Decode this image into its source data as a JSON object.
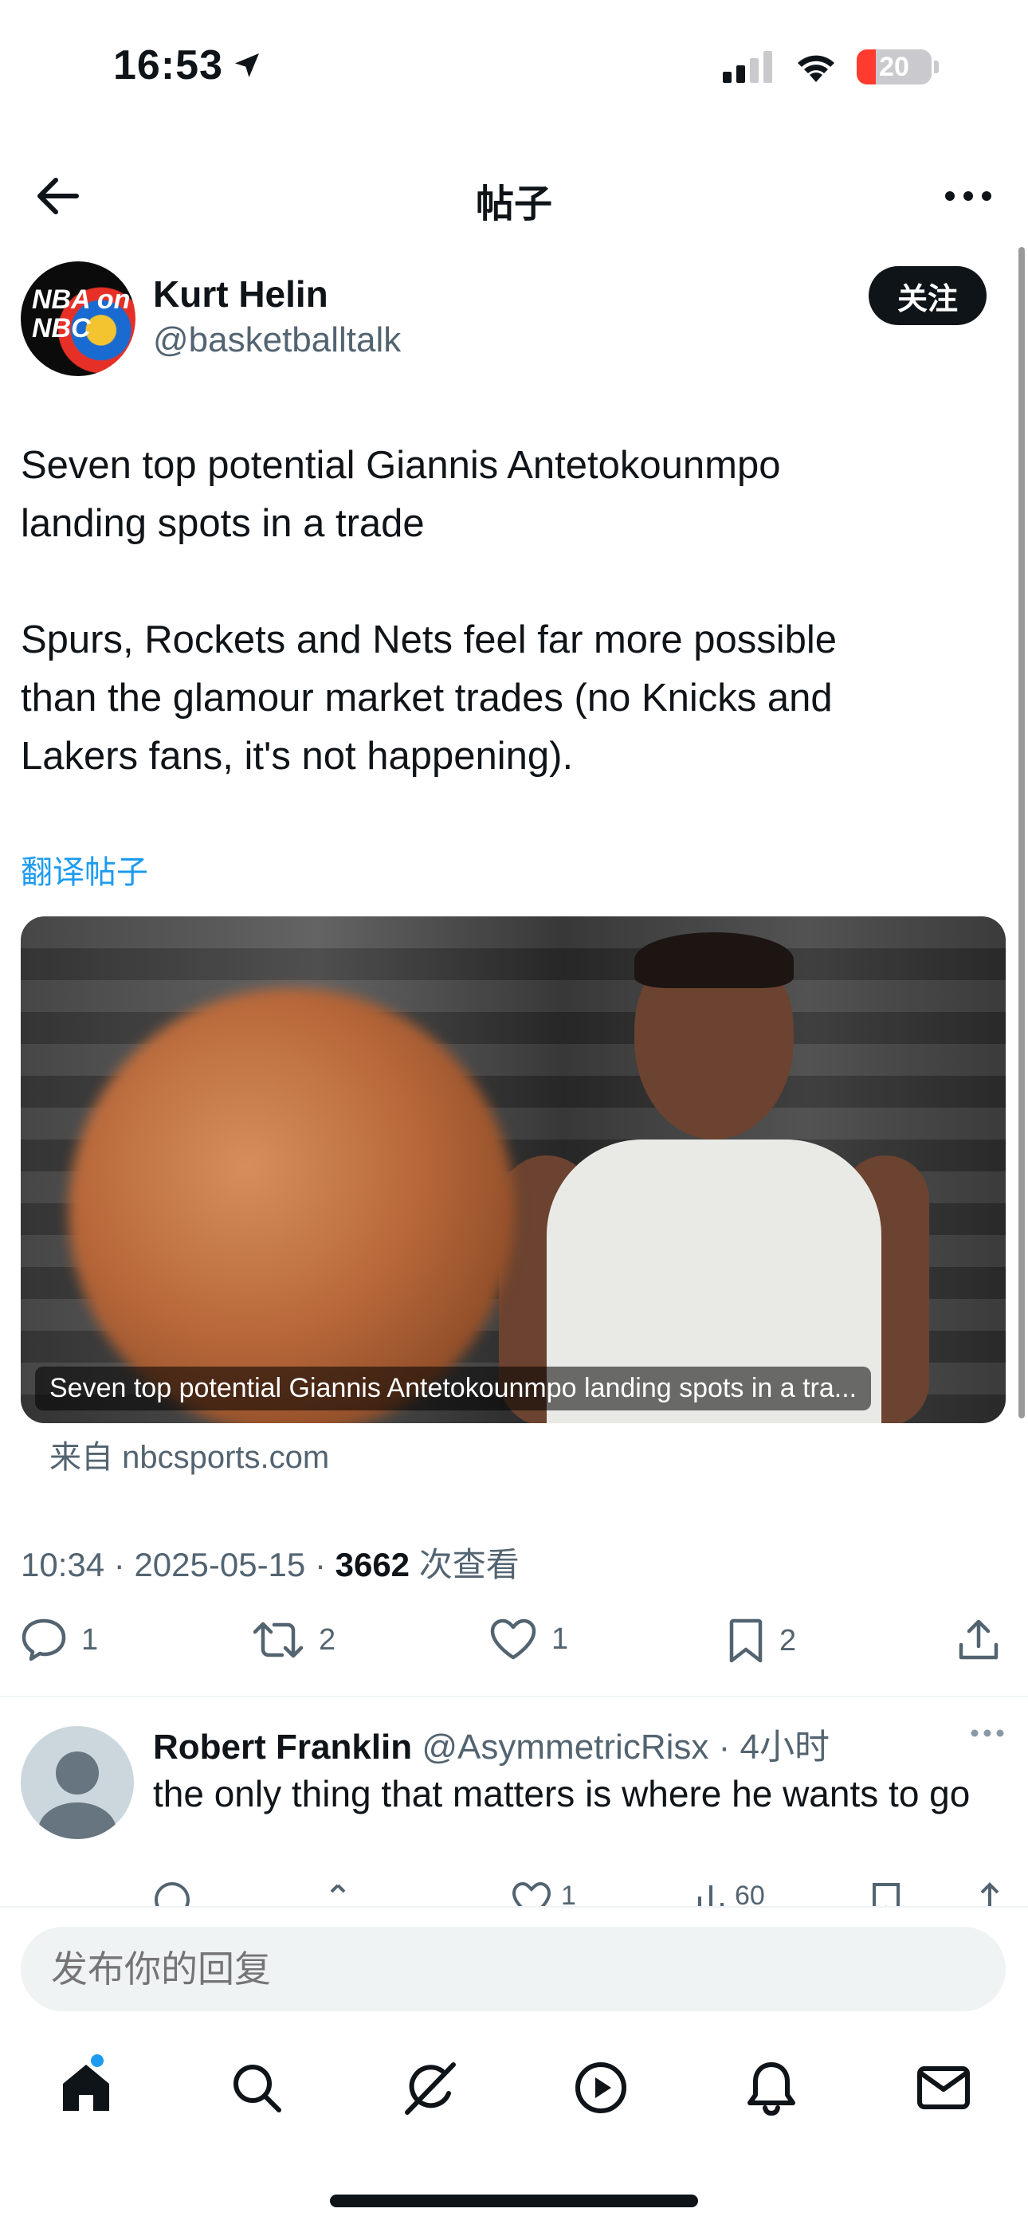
{
  "status_bar": {
    "time": "16:53",
    "battery": "20"
  },
  "header": {
    "title": "帖子"
  },
  "post": {
    "author_name": "Kurt Helin",
    "author_handle": "@basketballtalk",
    "avatar_text": "NBA on NBC",
    "follow_label": "关注",
    "text_lines": [
      "Seven top potential Giannis Antetokounmpo",
      "landing spots in a trade",
      "",
      "Spurs, Rockets and Nets feel far more possible",
      "than the glamour market trades (no Knicks and",
      "Lakers fans, it's not happening)."
    ],
    "translate_label": "翻译帖子",
    "media_caption": "Seven top potential Giannis Antetokounmpo landing spots in a tra...",
    "source": "来自 nbcsports.com",
    "time": "10:34",
    "date": "2025-05-15",
    "views": "3662",
    "views_label": "次查看",
    "stats": {
      "replies": "1",
      "reposts": "2",
      "likes": "1",
      "bookmarks": "2"
    }
  },
  "reply": {
    "name": "Robert Franklin",
    "handle": "@AsymmetricRisx",
    "time": "4小时",
    "text": "the only thing that matters is where he wants to go",
    "likes": "1",
    "views": "60"
  },
  "composer": {
    "placeholder": "发布你的回复"
  },
  "tabs": [
    "home-icon",
    "search-icon",
    "grok-icon",
    "video-icon",
    "notifications-icon",
    "messages-icon"
  ],
  "colors": {
    "accent": "#1d9bf0",
    "text": "#0f1419",
    "secondary": "#536471",
    "battery_low": "#ff3b30"
  }
}
